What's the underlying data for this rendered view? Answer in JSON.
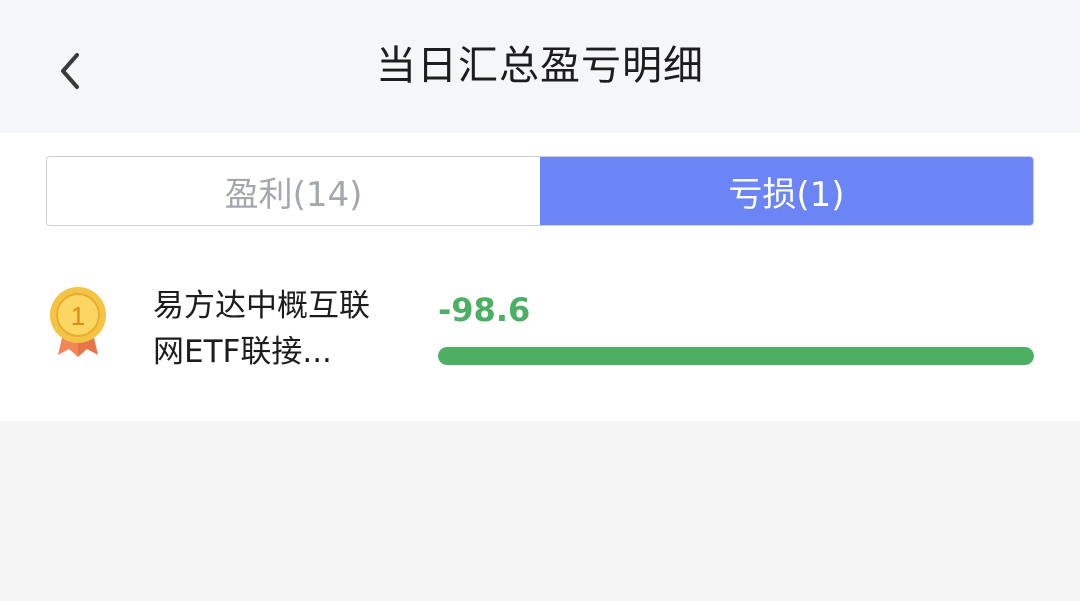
{
  "header": {
    "title": "当日汇总盈亏明细"
  },
  "tabs": [
    {
      "label": "盈利(14)",
      "active": false
    },
    {
      "label": "亏损(1)",
      "active": true
    }
  ],
  "items": [
    {
      "rank": "1",
      "name_line1": "易方达中概互联",
      "name_line2": "网ETF联接...",
      "value": "-98.6",
      "bar_fraction": 1.0
    }
  ],
  "colors": {
    "accent": "#6b85f7",
    "loss": "#4caf64",
    "medal_gold": "#f6c445",
    "medal_ribbon": "#f0865a"
  }
}
